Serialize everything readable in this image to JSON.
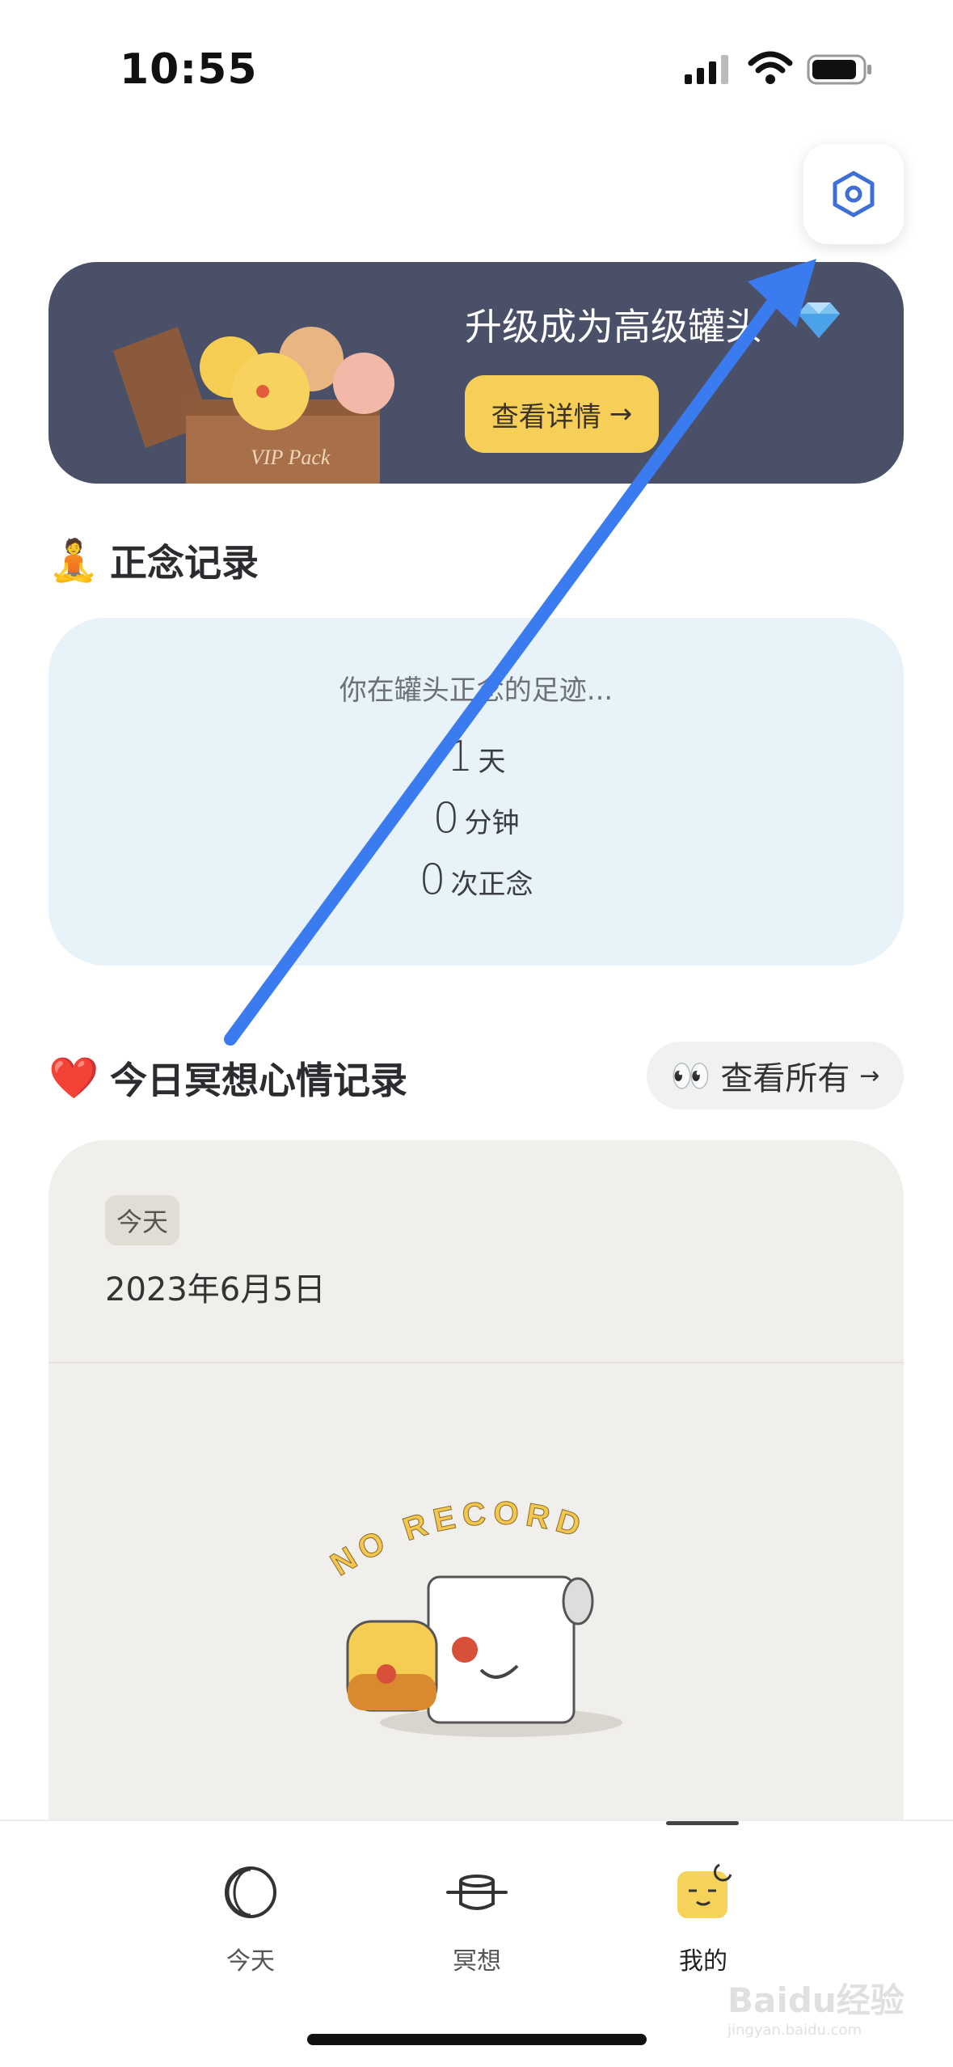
{
  "status_bar": {
    "time": "10:55",
    "icons": [
      "signal-icon",
      "wifi-icon",
      "battery-icon"
    ]
  },
  "settings_icon": "settings-hexagon-icon",
  "vip_banner": {
    "title": "升级成为高级罐头",
    "icon": "gem-icon",
    "button_label": "查看详情",
    "button_arrow": "→",
    "art_text": "VIP Pack"
  },
  "mindfulness": {
    "emoji": "🧘",
    "heading": "正念记录",
    "intro": "你在罐头正念的足迹...",
    "stats": [
      {
        "value": "1",
        "unit": "天"
      },
      {
        "value": "0",
        "unit": "分钟"
      },
      {
        "value": "0",
        "unit": "次正念"
      }
    ]
  },
  "mood": {
    "emoji": "❤️",
    "heading": "今日冥想心情记录",
    "view_all_emoji": "👀",
    "view_all_label": "查看所有",
    "view_all_arrow": "→",
    "badge": "今天",
    "date": "2023年6月5日",
    "empty_text": "NO RECORD"
  },
  "tabs": [
    {
      "label": "今天",
      "icon": "moon-icon"
    },
    {
      "label": "冥想",
      "icon": "pot-icon"
    },
    {
      "label": "我的",
      "icon": "profile-icon",
      "active": true
    }
  ],
  "watermark": {
    "text": "Baidu经验",
    "sub": "jingyan.baidu.com"
  },
  "colors": {
    "banner_bg": "#4a5067",
    "accent_yellow": "#f6cf58",
    "mindful_bg": "#e8f2f9",
    "mood_bg": "#f1efeb",
    "arrow_blue": "#3a7bf0"
  }
}
